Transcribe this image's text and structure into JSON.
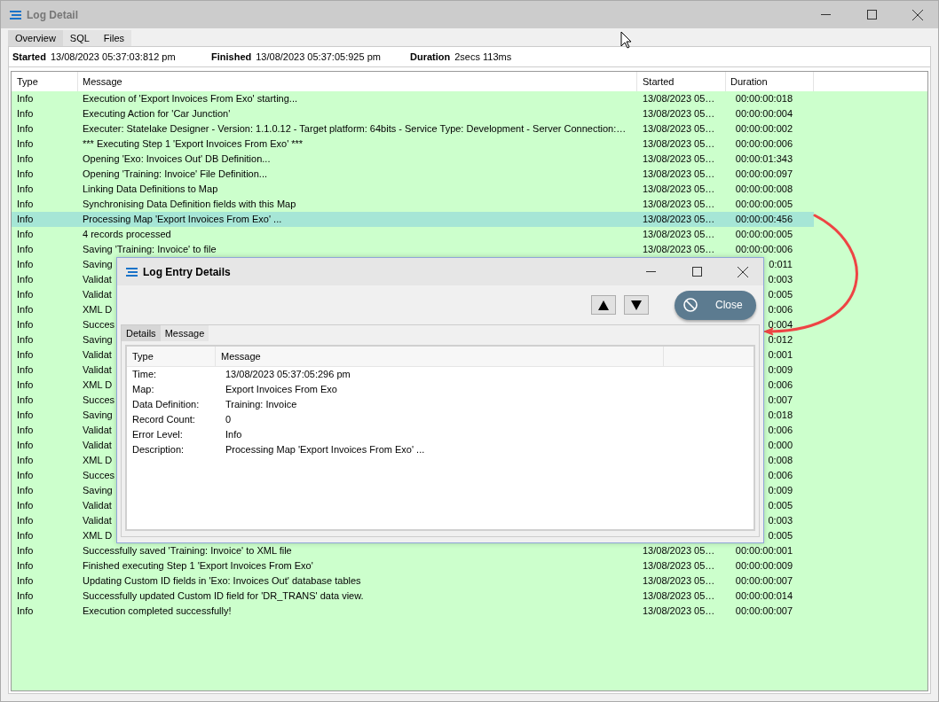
{
  "window": {
    "title": "Log Detail"
  },
  "tabs": [
    {
      "label": "Overview",
      "selected": true
    },
    {
      "label": "SQL",
      "selected": false
    },
    {
      "label": "Files",
      "selected": false
    }
  ],
  "summary": [
    {
      "label": "Started",
      "value": "13/08/2023 05:37:03:812 pm"
    },
    {
      "label": "Finished",
      "value": "13/08/2023 05:37:05:925 pm"
    },
    {
      "label": "Duration",
      "value": "2secs 113ms"
    }
  ],
  "table": {
    "columns": [
      "Type",
      "Message",
      "Started",
      "Duration"
    ],
    "rows": [
      {
        "type": "Info",
        "message": "Execution of 'Export Invoices From Exo' starting...",
        "started": "13/08/2023 05…",
        "duration": "00:00:00:018",
        "selected": false
      },
      {
        "type": "Info",
        "message": "Executing Action for 'Car Junction'",
        "started": "13/08/2023 05…",
        "duration": "00:00:00:004",
        "selected": false
      },
      {
        "type": "Info",
        "message": "Executer: Statelake Designer - Version: 1.1.0.12 - Target platform:  64bits - Service Type: Development - Server Connection:…",
        "started": "13/08/2023 05…",
        "duration": "00:00:00:002",
        "selected": false
      },
      {
        "type": "Info",
        "message": "*** Executing Step 1 'Export Invoices From Exo' ***",
        "started": "13/08/2023 05…",
        "duration": "00:00:00:006",
        "selected": false
      },
      {
        "type": "Info",
        "message": "Opening 'Exo: Invoices Out' DB Definition...",
        "started": "13/08/2023 05…",
        "duration": "00:00:01:343",
        "selected": false
      },
      {
        "type": "Info",
        "message": "Opening 'Training: Invoice' File Definition...",
        "started": "13/08/2023 05…",
        "duration": "00:00:00:097",
        "selected": false
      },
      {
        "type": "Info",
        "message": "Linking Data Definitions to Map",
        "started": "13/08/2023 05…",
        "duration": "00:00:00:008",
        "selected": false
      },
      {
        "type": "Info",
        "message": "Synchronising Data Definition fields with this Map",
        "started": "13/08/2023 05…",
        "duration": "00:00:00:005",
        "selected": false
      },
      {
        "type": "Info",
        "message": "Processing Map 'Export Invoices From Exo' ...",
        "started": "13/08/2023 05…",
        "duration": "00:00:00:456",
        "selected": true
      },
      {
        "type": "Info",
        "message": "4 records processed",
        "started": "13/08/2023 05…",
        "duration": "00:00:00:005",
        "selected": false
      },
      {
        "type": "Info",
        "message": "Saving 'Training: Invoice' to file",
        "started": "13/08/2023 05…",
        "duration": "00:00:00:006",
        "selected": false
      },
      {
        "type": "Info",
        "message": "Saving",
        "duration": "0:011",
        "selected": false
      },
      {
        "type": "Info",
        "message": "Validat",
        "duration": "0:003",
        "selected": false
      },
      {
        "type": "Info",
        "message": "Validat",
        "duration": "0:005",
        "selected": false
      },
      {
        "type": "Info",
        "message": "XML D",
        "duration": "0:006",
        "selected": false
      },
      {
        "type": "Info",
        "message": "Succes",
        "duration": "0:004",
        "selected": false
      },
      {
        "type": "Info",
        "message": "Saving",
        "duration": "0:012",
        "selected": false
      },
      {
        "type": "Info",
        "message": "Validat",
        "duration": "0:001",
        "selected": false
      },
      {
        "type": "Info",
        "message": "Validat",
        "duration": "0:009",
        "selected": false
      },
      {
        "type": "Info",
        "message": "XML D",
        "duration": "0:006",
        "selected": false
      },
      {
        "type": "Info",
        "message": "Succes",
        "duration": "0:007",
        "selected": false
      },
      {
        "type": "Info",
        "message": "Saving",
        "duration": "0:018",
        "selected": false
      },
      {
        "type": "Info",
        "message": "Validat",
        "duration": "0:006",
        "selected": false
      },
      {
        "type": "Info",
        "message": "Validat",
        "duration": "0:000",
        "selected": false
      },
      {
        "type": "Info",
        "message": "XML D",
        "duration": "0:008",
        "selected": false
      },
      {
        "type": "Info",
        "message": "Succes",
        "duration": "0:006",
        "selected": false
      },
      {
        "type": "Info",
        "message": "Saving",
        "duration": "0:009",
        "selected": false
      },
      {
        "type": "Info",
        "message": "Validat",
        "duration": "0:005",
        "selected": false
      },
      {
        "type": "Info",
        "message": "Validat",
        "duration": "0:003",
        "selected": false
      },
      {
        "type": "Info",
        "message": "XML D",
        "duration": "0:005",
        "selected": false
      },
      {
        "type": "Info",
        "message": "Successfully saved 'Training: Invoice' to XML file",
        "started": "13/08/2023 05…",
        "duration": "00:00:00:001",
        "selected": false
      },
      {
        "type": "Info",
        "message": "Finished executing Step 1 'Export Invoices From Exo'",
        "started": "13/08/2023 05…",
        "duration": "00:00:00:009",
        "selected": false
      },
      {
        "type": "Info",
        "message": "Updating Custom ID fields in 'Exo: Invoices Out' database tables",
        "started": "13/08/2023 05…",
        "duration": "00:00:00:007",
        "selected": false
      },
      {
        "type": "Info",
        "message": "Successfully updated Custom ID field for 'DR_TRANS' data view.",
        "started": "13/08/2023 05…",
        "duration": "00:00:00:014",
        "selected": false
      },
      {
        "type": "Info",
        "message": "Execution completed successfully!",
        "started": "13/08/2023 05…",
        "duration": "00:00:00:007",
        "selected": false
      }
    ]
  },
  "dialog": {
    "title": "Log Entry Details",
    "close_button": "Close",
    "tabs": [
      {
        "label": "Details",
        "selected": true
      },
      {
        "label": "Message",
        "selected": false
      }
    ],
    "columns": [
      "Type",
      "Message"
    ],
    "details": [
      {
        "key": "Time:",
        "value": "13/08/2023 05:37:05:296 pm"
      },
      {
        "key": "Map:",
        "value": "Export Invoices From Exo"
      },
      {
        "key": "Data Definition:",
        "value": "Training: Invoice"
      },
      {
        "key": "Record Count:",
        "value": "0"
      },
      {
        "key": "Error Level:",
        "value": "Info"
      },
      {
        "key": "Description:",
        "value": "Processing Map 'Export Invoices From Exo' ..."
      }
    ]
  }
}
